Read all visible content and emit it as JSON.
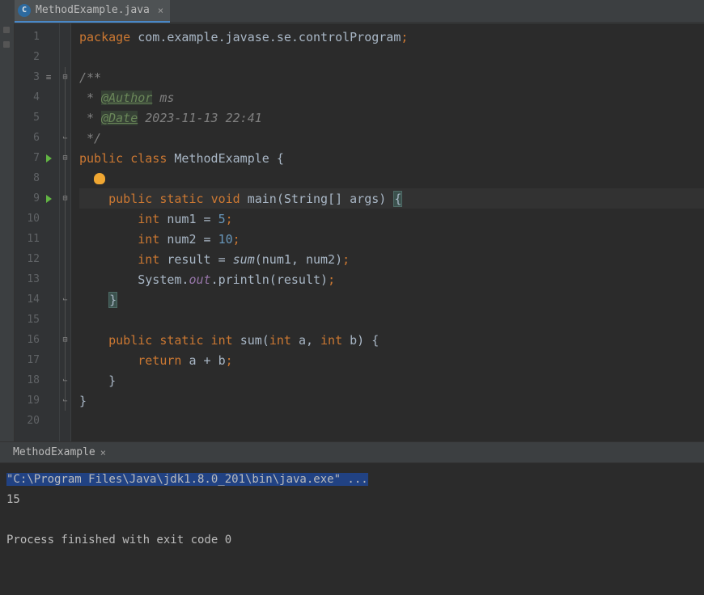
{
  "tab": {
    "label": "MethodExample.java",
    "icon_letter": "C"
  },
  "code": {
    "lines": [
      {
        "n": 1,
        "tokens": [
          [
            "kw",
            "package "
          ],
          [
            "ident",
            "com.example.javase.se.controlProgram"
          ],
          [
            "semicolon",
            ";"
          ]
        ]
      },
      {
        "n": 2,
        "tokens": []
      },
      {
        "n": 3,
        "list": true,
        "foldStart": true,
        "tokens": [
          [
            "comment",
            "/**"
          ]
        ]
      },
      {
        "n": 4,
        "tokens": [
          [
            "comment",
            " * "
          ],
          [
            "doc-tag",
            "@Author"
          ],
          [
            "comment",
            " ms"
          ]
        ]
      },
      {
        "n": 5,
        "tokens": [
          [
            "comment",
            " * "
          ],
          [
            "doc-tag",
            "@Date"
          ],
          [
            "comment",
            " 2023-11-13 22:41"
          ]
        ]
      },
      {
        "n": 6,
        "foldEnd": true,
        "tokens": [
          [
            "comment",
            " */"
          ]
        ]
      },
      {
        "n": 7,
        "run": true,
        "foldStart": true,
        "tokens": [
          [
            "kw",
            "public class "
          ],
          [
            "class-name",
            "MethodExample"
          ],
          [
            "ident",
            " {"
          ]
        ]
      },
      {
        "n": 8,
        "bulb": true,
        "tokens": []
      },
      {
        "n": 9,
        "run": true,
        "hl": true,
        "foldStart": true,
        "tokens": [
          [
            "ident",
            "    "
          ],
          [
            "kw",
            "public static "
          ],
          [
            "kw",
            "void "
          ],
          [
            "ident",
            "main(String[] args) "
          ],
          [
            "brace-hl",
            "{"
          ]
        ]
      },
      {
        "n": 10,
        "tokens": [
          [
            "ident",
            "        "
          ],
          [
            "kw",
            "int "
          ],
          [
            "ident",
            "num1 = "
          ],
          [
            "num",
            "5"
          ],
          [
            "semicolon",
            ";"
          ]
        ]
      },
      {
        "n": 11,
        "tokens": [
          [
            "ident",
            "        "
          ],
          [
            "kw",
            "int "
          ],
          [
            "ident",
            "num2 = "
          ],
          [
            "num",
            "10"
          ],
          [
            "semicolon",
            ";"
          ]
        ]
      },
      {
        "n": 12,
        "tokens": [
          [
            "ident",
            "        "
          ],
          [
            "kw",
            "int "
          ],
          [
            "ident",
            "result = "
          ],
          [
            "method-call-i",
            "sum"
          ],
          [
            "ident",
            "(num1, num2)"
          ],
          [
            "semicolon",
            ";"
          ]
        ]
      },
      {
        "n": 13,
        "tokens": [
          [
            "ident",
            "        System."
          ],
          [
            "static-field",
            "out"
          ],
          [
            "ident",
            ".println(result)"
          ],
          [
            "semicolon",
            ";"
          ]
        ]
      },
      {
        "n": 14,
        "foldEnd": true,
        "tokens": [
          [
            "ident",
            "    "
          ],
          [
            "brace-hl",
            "}"
          ]
        ]
      },
      {
        "n": 15,
        "tokens": []
      },
      {
        "n": 16,
        "foldStart": true,
        "tokens": [
          [
            "ident",
            "    "
          ],
          [
            "kw",
            "public static int "
          ],
          [
            "ident",
            "sum("
          ],
          [
            "kw",
            "int "
          ],
          [
            "ident",
            "a, "
          ],
          [
            "kw",
            "int "
          ],
          [
            "ident",
            "b) {"
          ]
        ]
      },
      {
        "n": 17,
        "tokens": [
          [
            "ident",
            "        "
          ],
          [
            "kw",
            "return "
          ],
          [
            "ident",
            "a + b"
          ],
          [
            "semicolon",
            ";"
          ]
        ]
      },
      {
        "n": 18,
        "foldEnd": true,
        "tokens": [
          [
            "ident",
            "    }"
          ]
        ]
      },
      {
        "n": 19,
        "foldEnd": true,
        "tokens": [
          [
            "ident",
            "}"
          ]
        ]
      },
      {
        "n": 20,
        "tokens": []
      }
    ]
  },
  "console": {
    "tab_label": "MethodExample",
    "cmd": "\"C:\\Program Files\\Java\\jdk1.8.0_201\\bin\\java.exe\" ...",
    "output": "15",
    "footer": "Process finished with exit code 0"
  }
}
